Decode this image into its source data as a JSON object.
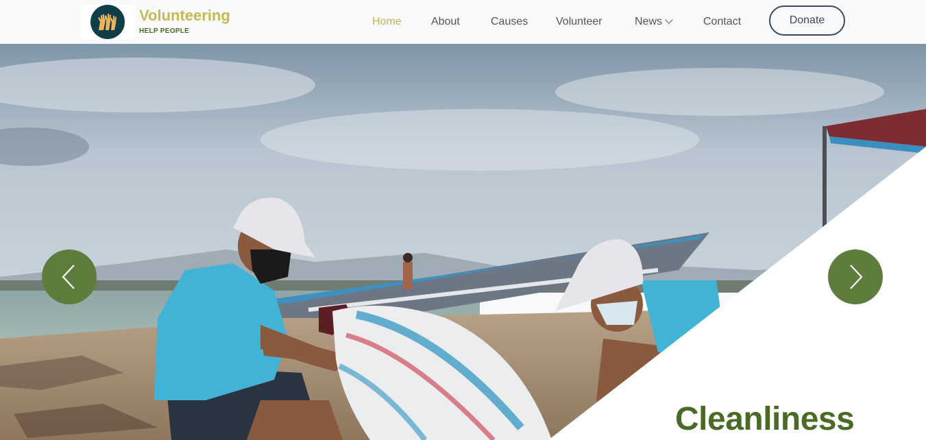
{
  "brand": {
    "title": "Volunteering",
    "subtitle": "HELP PEOPLE",
    "logo_icon": "raised-hands-icon"
  },
  "nav": {
    "items": [
      {
        "label": "Home",
        "active": true
      },
      {
        "label": "About",
        "active": false
      },
      {
        "label": "Causes",
        "active": false
      },
      {
        "label": "Volunteer",
        "active": false
      },
      {
        "label": "News",
        "active": false,
        "dropdown": true
      },
      {
        "label": "Contact",
        "active": false
      }
    ],
    "donate_label": "Donate"
  },
  "hero": {
    "slide_title": "Cleanliness",
    "prev_icon": "chevron-left-icon",
    "next_icon": "chevron-right-icon",
    "image": "beach-cleanup-photo"
  },
  "colors": {
    "brand_gold": "#c6b94f",
    "brand_green": "#4a6b25",
    "carousel_button": "#5e7c3c",
    "nav_active": "#c9b35a",
    "logo_circle": "#0f3d48"
  }
}
